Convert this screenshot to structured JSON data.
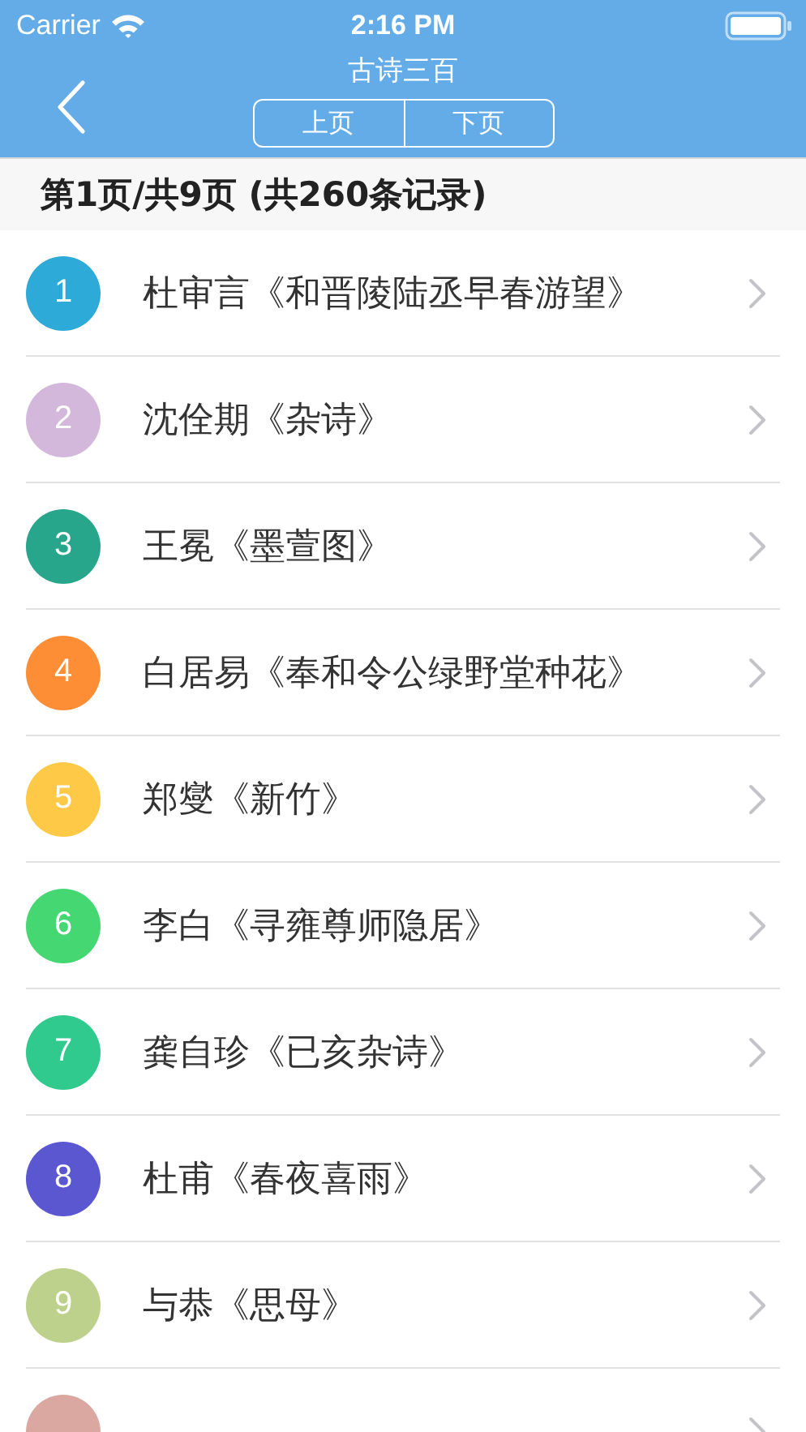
{
  "status_bar": {
    "carrier": "Carrier",
    "time": "2:16 PM"
  },
  "nav": {
    "title": "古诗三百",
    "buttons": [
      {
        "label": "上页"
      },
      {
        "label": "下页"
      }
    ]
  },
  "summary": "第1页/共9页 (共260条记录)",
  "items": [
    {
      "number": "1",
      "text": "杜审言《和晋陵陆丞早春游望》",
      "color": "#2eaad8"
    },
    {
      "number": "2",
      "text": "沈佺期《杂诗》",
      "color": "#d4b8dc"
    },
    {
      "number": "3",
      "text": "王冕《墨萱图》",
      "color": "#27a68b"
    },
    {
      "number": "4",
      "text": "白居易《奉和令公绿野堂种花》",
      "color": "#fd8e35"
    },
    {
      "number": "5",
      "text": "郑燮《新竹》",
      "color": "#fec947"
    },
    {
      "number": "6",
      "text": "李白《寻雍尊师隐居》",
      "color": "#45d872"
    },
    {
      "number": "7",
      "text": "龚自珍《已亥杂诗》",
      "color": "#30c98e"
    },
    {
      "number": "8",
      "text": "杜甫《春夜喜雨》",
      "color": "#5a57d1"
    },
    {
      "number": "9",
      "text": "与恭《思母》",
      "color": "#bdd18c"
    },
    {
      "color": "#dba7a1"
    }
  ]
}
